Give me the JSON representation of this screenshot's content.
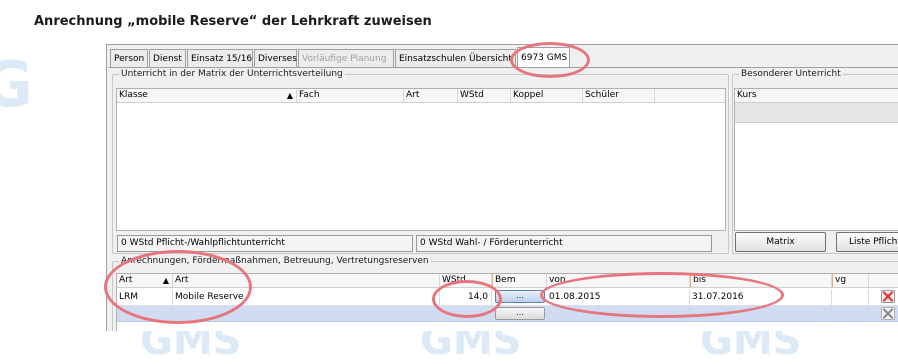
{
  "page": {
    "title": "Anrechnung „mobile Reserve“ der Lehrkraft zuweisen"
  },
  "watermark": {
    "text": "GMS"
  },
  "tabs": [
    {
      "label": "Person",
      "state": "normal"
    },
    {
      "label": "Dienst",
      "state": "normal"
    },
    {
      "label": "Einsatz 15/16",
      "state": "normal"
    },
    {
      "label": "Diverses",
      "state": "normal"
    },
    {
      "label": "Vorläufige Planung",
      "state": "disabled"
    },
    {
      "label": "Einsatzschulen Übersicht",
      "state": "normal"
    },
    {
      "label": "6973 GMS",
      "state": "active"
    }
  ],
  "unterricht": {
    "title": "Unterricht in der Matrix der Unterrichtsverteilung",
    "columns": [
      "Klasse",
      "Fach",
      "Art",
      "WStd",
      "Koppel",
      "Schüler"
    ],
    "sort_indicator": "▲",
    "summary_left": "0 WStd Pflicht-/Wahlpflichtunterricht",
    "summary_right": "0 WStd Wahl- / Förderunterricht"
  },
  "besonderer": {
    "title": "Besonderer Unterricht",
    "column": "Kurs",
    "buttons": {
      "matrix": "Matrix",
      "liste": "Liste Pflicht"
    }
  },
  "anrechnungen": {
    "title": "Anrechnungen, Fördermaßnahmen, Betreuung, Vertretungsreserven",
    "columns": {
      "art_code": "Art",
      "art": "Art",
      "wstd": "WStd",
      "bem": "Bem",
      "von": "von",
      "bis": "bis",
      "vg": "vg"
    },
    "sort_indicator": "▲",
    "rows": [
      {
        "art_code": "LRM",
        "art": "Mobile Reserve",
        "wstd": "14,0",
        "bem_button": "...",
        "von": "01.08.2015",
        "bis": "31.07.2016",
        "vg": ""
      },
      {
        "art_code": "",
        "art": "",
        "wstd": "",
        "bem_button": "...",
        "von": "",
        "bis": "",
        "vg": ""
      }
    ]
  },
  "colors": {
    "highlight_circle": "#e8747c",
    "row_selected": "#cfdcf2",
    "delete_icon": "#d83a3a"
  }
}
